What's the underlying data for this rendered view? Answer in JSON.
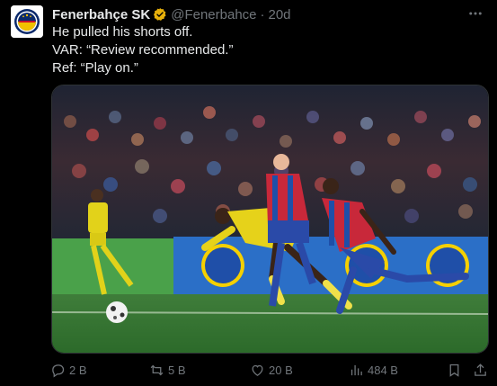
{
  "tweet": {
    "author_name": "Fenerbahçe SK",
    "handle": "@Fenerbahce",
    "separator": "·",
    "time": "20d",
    "text_lines": [
      "He pulled his shorts off.",
      "VAR: “Review recommended.”",
      "Ref: “Play on.”"
    ],
    "image_alt": "Football match photo: players in yellow and in red-blue kits chasing the ball at night"
  },
  "actions": {
    "replies": "2 B",
    "reposts": "5 B",
    "likes": "20 B",
    "views": "484 B"
  },
  "icons": {
    "verified": "gold-verified-badge-icon",
    "more": "more-options-icon",
    "reply": "reply-icon",
    "repost": "repost-icon",
    "like": "heart-icon",
    "views": "views-bar-chart-icon",
    "bookmark": "bookmark-icon",
    "share": "share-icon"
  },
  "colors": {
    "background": "#000000",
    "text": "#e7e9ea",
    "muted": "#71767b",
    "verified_gold": "#e8b10b"
  }
}
